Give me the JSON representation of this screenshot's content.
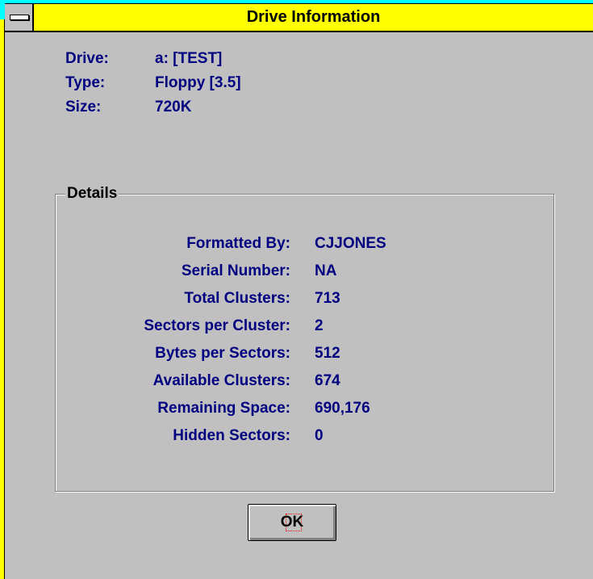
{
  "window": {
    "title": "Drive Information"
  },
  "drive": {
    "drive_label": "Drive:",
    "drive_value": "a:  [TEST]",
    "type_label": "Type:",
    "type_value": "Floppy [3.5]",
    "size_label": "Size:",
    "size_value": "720K"
  },
  "details": {
    "legend": "Details",
    "rows": [
      {
        "label": "Formatted By:",
        "value": "CJJONES"
      },
      {
        "label": "Serial Number:",
        "value": "NA"
      },
      {
        "label": "Total Clusters:",
        "value": "713"
      },
      {
        "label": "Sectors per Cluster:",
        "value": "2"
      },
      {
        "label": "Bytes per Sectors:",
        "value": "512"
      },
      {
        "label": "Available Clusters:",
        "value": "674"
      },
      {
        "label": "Remaining Space:",
        "value": "690,176"
      },
      {
        "label": "Hidden Sectors:",
        "value": "0"
      }
    ]
  },
  "buttons": {
    "ok_label": "OK"
  },
  "colors": {
    "titlebar": "#ffff00",
    "frame_accent": "#00ffff",
    "client_bg": "#c0c0c0",
    "text_blue": "#000080"
  },
  "icons": {
    "system_menu": "system-menu-icon"
  }
}
